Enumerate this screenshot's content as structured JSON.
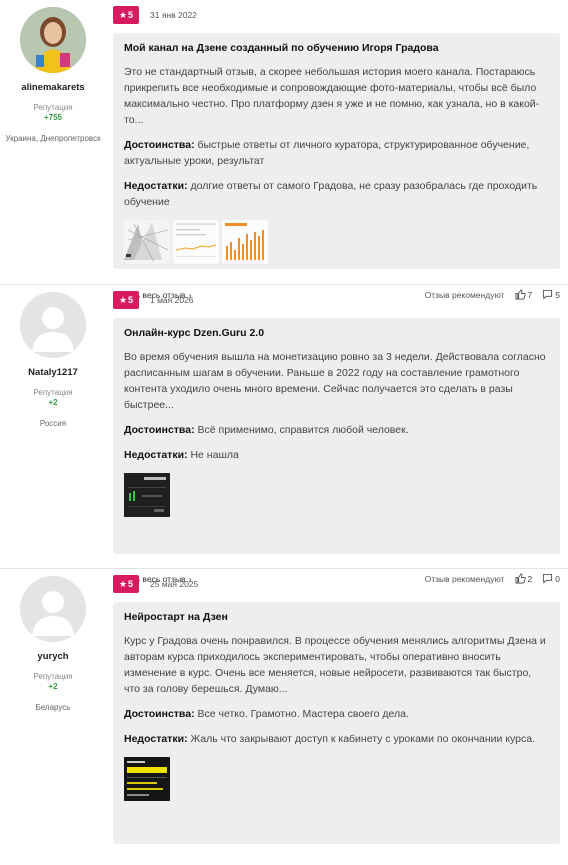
{
  "reviews": [
    {
      "author": {
        "name": "alinemakarets",
        "rep_label": "Репутация",
        "rep_value": "+755",
        "location": "Украина, Днепропетровск"
      },
      "rating": "5",
      "date": "31 янв 2022",
      "title": "Мой канал на Дзене созданный по обучению Игоря Градова",
      "text": "Это не стандартный отзыв, а скорее небольшая история моего канала. Постараюсь прикрепить все необходимые и сопровождающие фото-материалы, чтобы всё было максимально честно. Про платформу дзен я уже и не помню, как узнала, но в какой-то...",
      "pros_label": "Достоинства:",
      "pros": "быстрые ответы от личного куратора, структурированное обучение, актуальные уроки, результат",
      "cons_label": "Недостатки:",
      "cons": "долгие ответы от самого Градова, не сразу разобралась где проходить обучение",
      "read_more": "Читать весь отзыв",
      "recommend": "Отзыв рекомендуют",
      "likes": "7",
      "comments": "5"
    },
    {
      "author": {
        "name": "Nataly1217",
        "rep_label": "Репутация",
        "rep_value": "+2",
        "location": "Россия"
      },
      "rating": "5",
      "date": "1 мая 2026",
      "title": "Онлайн-курс Dzen.Guru 2.0",
      "text": "Во время обучения вышла на монетизацию ровно за 3 недели. Действовала согласно расписанным шагам в обучении. Раньше в 2022 году на составление грамотного контента уходило очень много времени. Сейчас получается это сделать в разы быстрее...",
      "pros_label": "Достоинства:",
      "pros": "Всё применимо, справится любой человек.",
      "cons_label": "Недостатки:",
      "cons": "Не нашла",
      "read_more": "Читать весь отзыв",
      "recommend": "Отзыв рекомендуют",
      "likes": "2",
      "comments": "0"
    },
    {
      "author": {
        "name": "yurych",
        "rep_label": "Репутация",
        "rep_value": "+2",
        "location": "Беларусь"
      },
      "rating": "5",
      "date": "25 мая 2025",
      "title": "Нейростарт на Дзен",
      "text": "Курс у Градова очень понравился. В процессе обучения менялись алгоритмы Дзена и авторам курса приходилось экспериментировать, чтобы оперативно вносить изменение в курс. Очень все меняется, новые нейросети, развиваются так быстро, что за голову берешься. Думаю...",
      "pros_label": "Достоинства:",
      "pros": "Все четко. Грамотно. Мастера своего дела.",
      "cons_label": "Недостатки:",
      "cons": "Жаль что закрывают доступ к кабинету с уроками по окончании курса."
    }
  ],
  "colors": {
    "badge": "#d81b60",
    "reputation": "#2e9c3d",
    "card_bg": "#eeeeee"
  },
  "icons": {
    "rating": "star-icon",
    "like": "thumbs-up-icon",
    "comment": "comment-icon",
    "more": "chevron-right-icon"
  }
}
